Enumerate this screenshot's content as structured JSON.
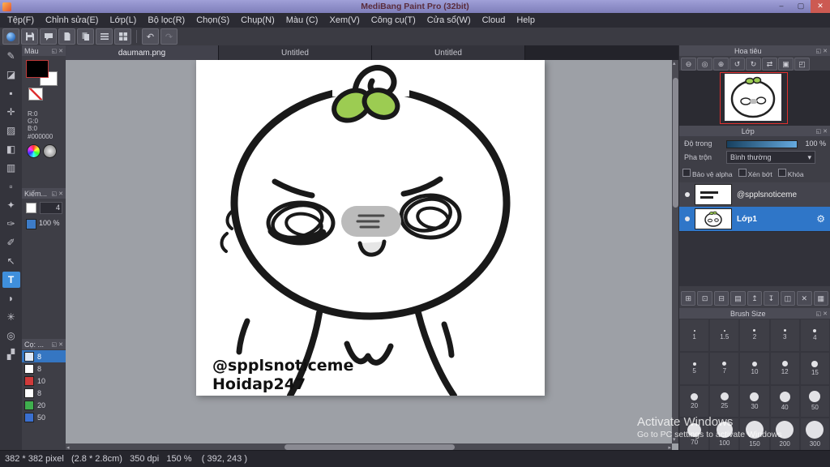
{
  "titlebar": {
    "title": "MediBang Paint Pro (32bit)",
    "minimize_glyph": "–",
    "maximize_glyph": "▢",
    "close_glyph": "✕"
  },
  "menubar": {
    "items": [
      "Tệp(F)",
      "Chỉnh sửa(E)",
      "Lớp(L)",
      "Bộ lọc(R)",
      "Chọn(S)",
      "Chụp(N)",
      "Màu (C)",
      "Xem(V)",
      "Công cụ(T)",
      "Cửa sổ(W)",
      "Cloud",
      "Help"
    ]
  },
  "toolbar": {
    "undo_glyph": "↶",
    "redo_glyph": "↷"
  },
  "glyphs": {
    "caret": "▾",
    "scroll_left": "◂",
    "scroll_right": "▸",
    "scroll_up": "▴",
    "scroll_down": "▾"
  },
  "panel_glyphs": {
    "float": "◱",
    "close": "✕"
  },
  "tool_strip": [
    {
      "name": "brush",
      "glyph": "✎"
    },
    {
      "name": "eraser",
      "glyph": "◪"
    },
    {
      "name": "dot",
      "glyph": "▪"
    },
    {
      "name": "move",
      "glyph": "✛"
    },
    {
      "name": "fill",
      "glyph": "▨"
    },
    {
      "name": "bucket",
      "glyph": "◧"
    },
    {
      "name": "gradient",
      "glyph": "▥"
    },
    {
      "name": "select",
      "glyph": "▫"
    },
    {
      "name": "magic-wand",
      "glyph": "✦"
    },
    {
      "name": "select-pen",
      "glyph": "✑"
    },
    {
      "name": "select-eraser",
      "glyph": "✐"
    },
    {
      "name": "operation",
      "glyph": "↖"
    },
    {
      "name": "text",
      "glyph": "T"
    },
    {
      "name": "eyedropper",
      "glyph": "◗"
    },
    {
      "name": "hand",
      "glyph": "✳"
    },
    {
      "name": "zoom",
      "glyph": "◎"
    },
    {
      "name": "divide",
      "glyph": "▞"
    }
  ],
  "color_panel": {
    "title": "Màu",
    "r": "R:0",
    "g": "G:0",
    "b": "B:0",
    "hex": "#000000",
    "foreground_color": "#000000",
    "background_color": "#ffffff"
  },
  "brush_control_panel": {
    "title": "Kiếm...",
    "size_value": "4",
    "opacity_value": "100 %"
  },
  "brush_list_panel": {
    "title": "Cọ: ...",
    "items": [
      {
        "label": "8",
        "color": "#dce8f8",
        "selected": true
      },
      {
        "label": "8",
        "color": "#ffffff",
        "selected": false
      },
      {
        "label": "10",
        "color": "#d03a3a",
        "selected": false
      },
      {
        "label": "8",
        "color": "#ffffff",
        "selected": false
      },
      {
        "label": "20",
        "color": "#3fae4e",
        "selected": false
      },
      {
        "label": "50",
        "color": "#3a6fd0",
        "selected": false
      }
    ]
  },
  "tabs": {
    "items": [
      "daumam.png",
      "Untitled",
      "Untitled"
    ]
  },
  "canvas": {
    "watermark_line1": "@spplsnoticeme",
    "watermark_line2": "Hoidap247"
  },
  "navigator": {
    "title": "Hoa tiêu",
    "buttons": [
      {
        "name": "zoom-out",
        "glyph": "⊖"
      },
      {
        "name": "zoom-100",
        "glyph": "◎"
      },
      {
        "name": "zoom-in",
        "glyph": "⊕"
      },
      {
        "name": "rotate-left",
        "glyph": "↺"
      },
      {
        "name": "rotate-right",
        "glyph": "↻"
      },
      {
        "name": "flip",
        "glyph": "⇄"
      },
      {
        "name": "fit-window",
        "glyph": "▣"
      },
      {
        "name": "reset-view",
        "glyph": "◰"
      }
    ]
  },
  "layers_panel": {
    "title": "Lớp",
    "opacity_label": "Độ trong",
    "opacity_value": "100 %",
    "blend_label": "Pha trộn",
    "blend_value": "Bình thường",
    "checkboxes": [
      "Bảo vệ alpha",
      "Xén bớt",
      "Khóa"
    ],
    "gear_glyph": "⚙",
    "layers": [
      {
        "name": "@spplsnoticeme",
        "selected": false
      },
      {
        "name": "Lớp1",
        "selected": true
      }
    ],
    "buttons": [
      {
        "name": "new-layer",
        "glyph": "⊞"
      },
      {
        "name": "duplicate-layer",
        "glyph": "⊡"
      },
      {
        "name": "merge-layer",
        "glyph": "⊟"
      },
      {
        "name": "layer-folder",
        "glyph": "▤"
      },
      {
        "name": "move-layer-up",
        "glyph": "↥"
      },
      {
        "name": "move-layer-down",
        "glyph": "↧"
      },
      {
        "name": "clear-layer",
        "glyph": "◫"
      },
      {
        "name": "delete-layer",
        "glyph": "✕"
      },
      {
        "name": "layer-settings",
        "glyph": "▦"
      }
    ]
  },
  "brush_size_panel": {
    "title": "Brush Size",
    "sizes": [
      "1",
      "1.5",
      "2",
      "3",
      "4",
      "5",
      "7",
      "10",
      "12",
      "15",
      "20",
      "25",
      "30",
      "40",
      "50",
      "70",
      "100",
      "150",
      "200",
      "300"
    ]
  },
  "statusbar": {
    "info": "382 * 382 pixel   (2.8 * 2.8cm)   350 dpi   150 %    ( 392, 243 )"
  },
  "watermark": {
    "line1": "Activate Windows",
    "line2": "Go to PC settings to activate Windows"
  }
}
